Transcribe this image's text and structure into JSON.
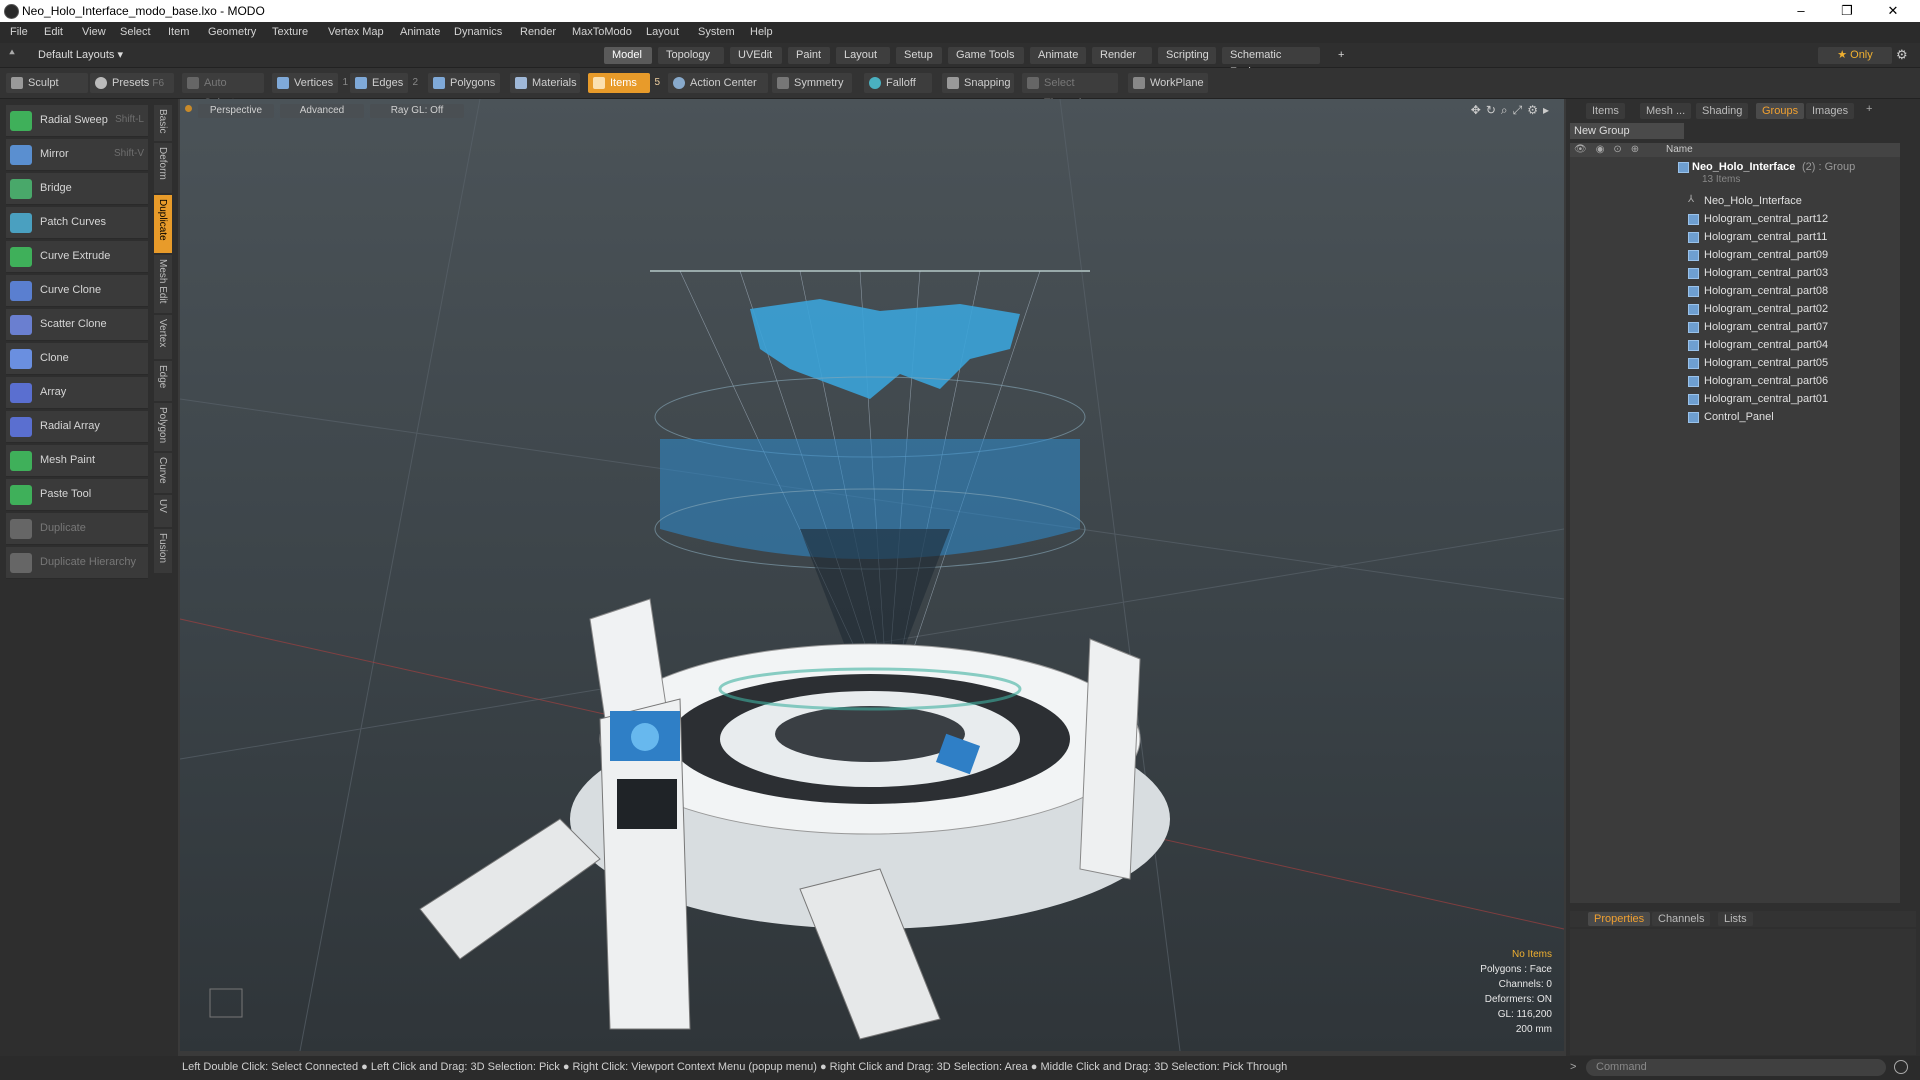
{
  "window": {
    "title": "Neo_Holo_Interface_modo_base.lxo - MODO",
    "minimize": "–",
    "restore": "❐",
    "close": "✕"
  },
  "menu": [
    "File",
    "Edit",
    "View",
    "Select",
    "Item",
    "Geometry",
    "Texture",
    "Vertex Map",
    "Animate",
    "Dynamics",
    "Render",
    "MaxToModo",
    "Layout",
    "System",
    "Help"
  ],
  "layout_selector": "Default Layouts ▾",
  "tabs": [
    "Model",
    "Topology",
    "UVEdit",
    "Paint",
    "Layout",
    "Setup",
    "Game Tools",
    "Animate",
    "Render",
    "Scripting",
    "Schematic Fusion"
  ],
  "tabs_active": "Model",
  "tabs_add": "+",
  "only_label": "★  Only",
  "toolbar": {
    "sculpt": "Sculpt",
    "presets": "Presets",
    "presets_shortcut": "F6",
    "auto_select": "Auto Select",
    "vertices": "Vertices",
    "vertices_count": "1",
    "edges": "Edges",
    "edges_count": "2",
    "polygons": "Polygons",
    "materials": "Materials",
    "items": "Items",
    "items_count": "5",
    "action_center": "Action Center",
    "symmetry": "Symmetry",
    "falloff": "Falloff",
    "snapping": "Snapping",
    "select_through": "Select Through",
    "workplane": "WorkPlane"
  },
  "tools": [
    {
      "label": "Radial Sweep",
      "shortcut": "Shift-L",
      "color": "#3fb05a"
    },
    {
      "label": "Mirror",
      "shortcut": "Shift-V",
      "color": "#5a8fd0"
    },
    {
      "label": "Bridge",
      "shortcut": "",
      "color": "#49a86a"
    },
    {
      "label": "Patch Curves",
      "shortcut": "",
      "color": "#4aa0c0"
    },
    {
      "label": "Curve Extrude",
      "shortcut": "",
      "color": "#3fb05a"
    },
    {
      "label": "Curve Clone",
      "shortcut": "",
      "color": "#5a7fd0"
    },
    {
      "label": "Scatter Clone",
      "shortcut": "",
      "color": "#6a7fd0"
    },
    {
      "label": "Clone",
      "shortcut": "",
      "color": "#6a8fe0"
    },
    {
      "label": "Array",
      "shortcut": "",
      "color": "#5a6fd0"
    },
    {
      "label": "Radial Array",
      "shortcut": "",
      "color": "#5a6fd0"
    },
    {
      "label": "Mesh Paint",
      "shortcut": "",
      "color": "#3fb05a"
    },
    {
      "label": "Paste Tool",
      "shortcut": "",
      "color": "#3fb05a"
    },
    {
      "label": "Duplicate",
      "shortcut": "",
      "color": "#666666"
    },
    {
      "label": "Duplicate Hierarchy",
      "shortcut": "",
      "color": "#666666"
    }
  ],
  "vertical_tabs": [
    "Basic",
    "Deform",
    "Duplicate",
    "Mesh Edit",
    "Vertex",
    "Edge",
    "Polygon",
    "Curve",
    "UV",
    "Fusion"
  ],
  "vertical_tabs_active": "Duplicate",
  "viewport": {
    "perspective": "Perspective",
    "advanced": "Advanced",
    "raygl": "Ray GL: Off",
    "hud": {
      "no_items": "No Items",
      "polygons": "Polygons : Face",
      "channels": "Channels: 0",
      "deformers": "Deformers: ON",
      "gl": "GL: 116,200",
      "scale": "200 mm"
    }
  },
  "right_tabs": [
    "Items",
    "Mesh ...",
    "Shading",
    "Groups",
    "Images"
  ],
  "right_tabs_active": "Groups",
  "new_group": "New Group",
  "outliner": {
    "name_header": "Name",
    "group_name": "Neo_Holo_Interface",
    "group_suffix": "(2) : Group",
    "group_count": "13 Items",
    "items": [
      "Neo_Holo_Interface",
      "Hologram_central_part12",
      "Hologram_central_part11",
      "Hologram_central_part09",
      "Hologram_central_part03",
      "Hologram_central_part08",
      "Hologram_central_part02",
      "Hologram_central_part07",
      "Hologram_central_part04",
      "Hologram_central_part05",
      "Hologram_central_part06",
      "Hologram_central_part01",
      "Control_Panel"
    ]
  },
  "bottom_tabs": [
    "Properties",
    "Channels",
    "Lists"
  ],
  "bottom_tabs_active": "Properties",
  "status": "Left Double Click: Select Connected ● Left Click and Drag: 3D Selection: Pick ● Right Click: Viewport Context Menu (popup menu) ● Right Click and Drag: 3D Selection: Area ● Middle Click and Drag: 3D Selection: Pick Through",
  "command_placeholder": "Command"
}
